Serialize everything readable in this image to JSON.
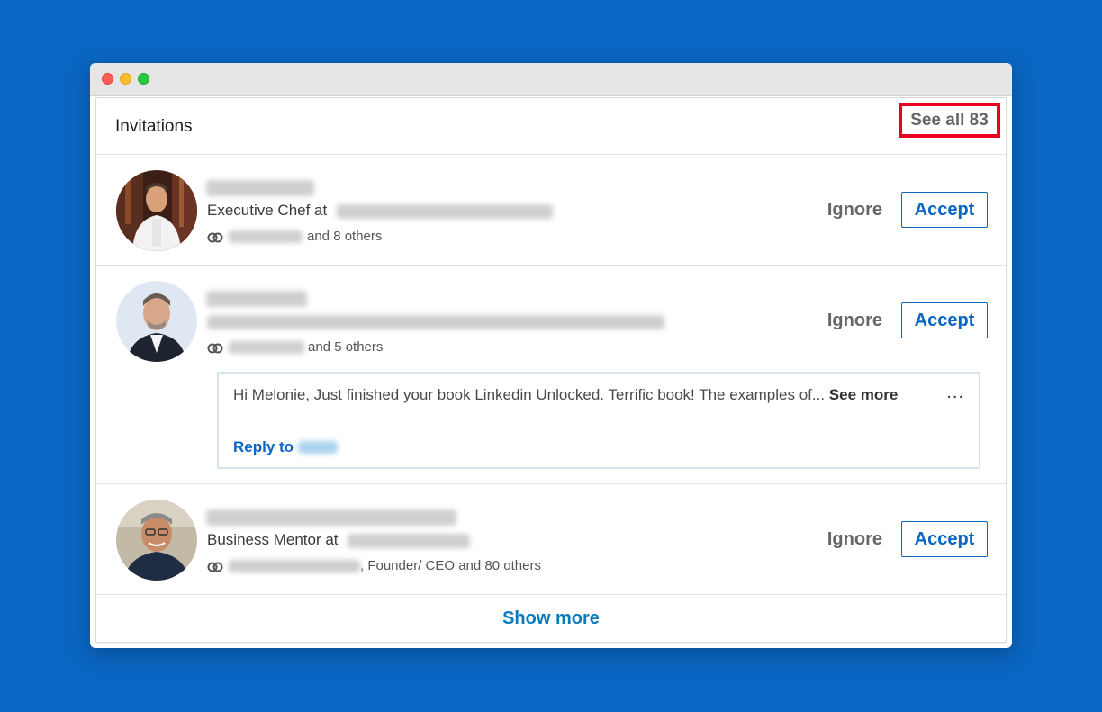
{
  "header": {
    "title": "Invitations",
    "see_all": "See all 83"
  },
  "invitations": [
    {
      "headline_prefix": "Executive Chef at",
      "mutual_suffix": "and 8 others",
      "ignore_label": "Ignore",
      "accept_label": "Accept"
    },
    {
      "mutual_suffix": "and 5 others",
      "ignore_label": "Ignore",
      "accept_label": "Accept",
      "message": {
        "text": "Hi Melonie, Just finished your book Linkedin Unlocked. Terrific book! The examples of...",
        "see_more": "See more",
        "reply_prefix": "Reply to",
        "menu": "..."
      }
    },
    {
      "headline_prefix": "Business Mentor at",
      "mutual_suffix": ", Founder/ CEO and 80 others",
      "ignore_label": "Ignore",
      "accept_label": "Accept"
    }
  ],
  "footer": {
    "show_more": "Show more"
  },
  "colors": {
    "background": "#0a66c2",
    "accent": "#0a66c2",
    "highlight_box": "#e8001c"
  },
  "icons": {
    "mutual": "shared-connections-icon",
    "menu": "more-options-icon"
  }
}
